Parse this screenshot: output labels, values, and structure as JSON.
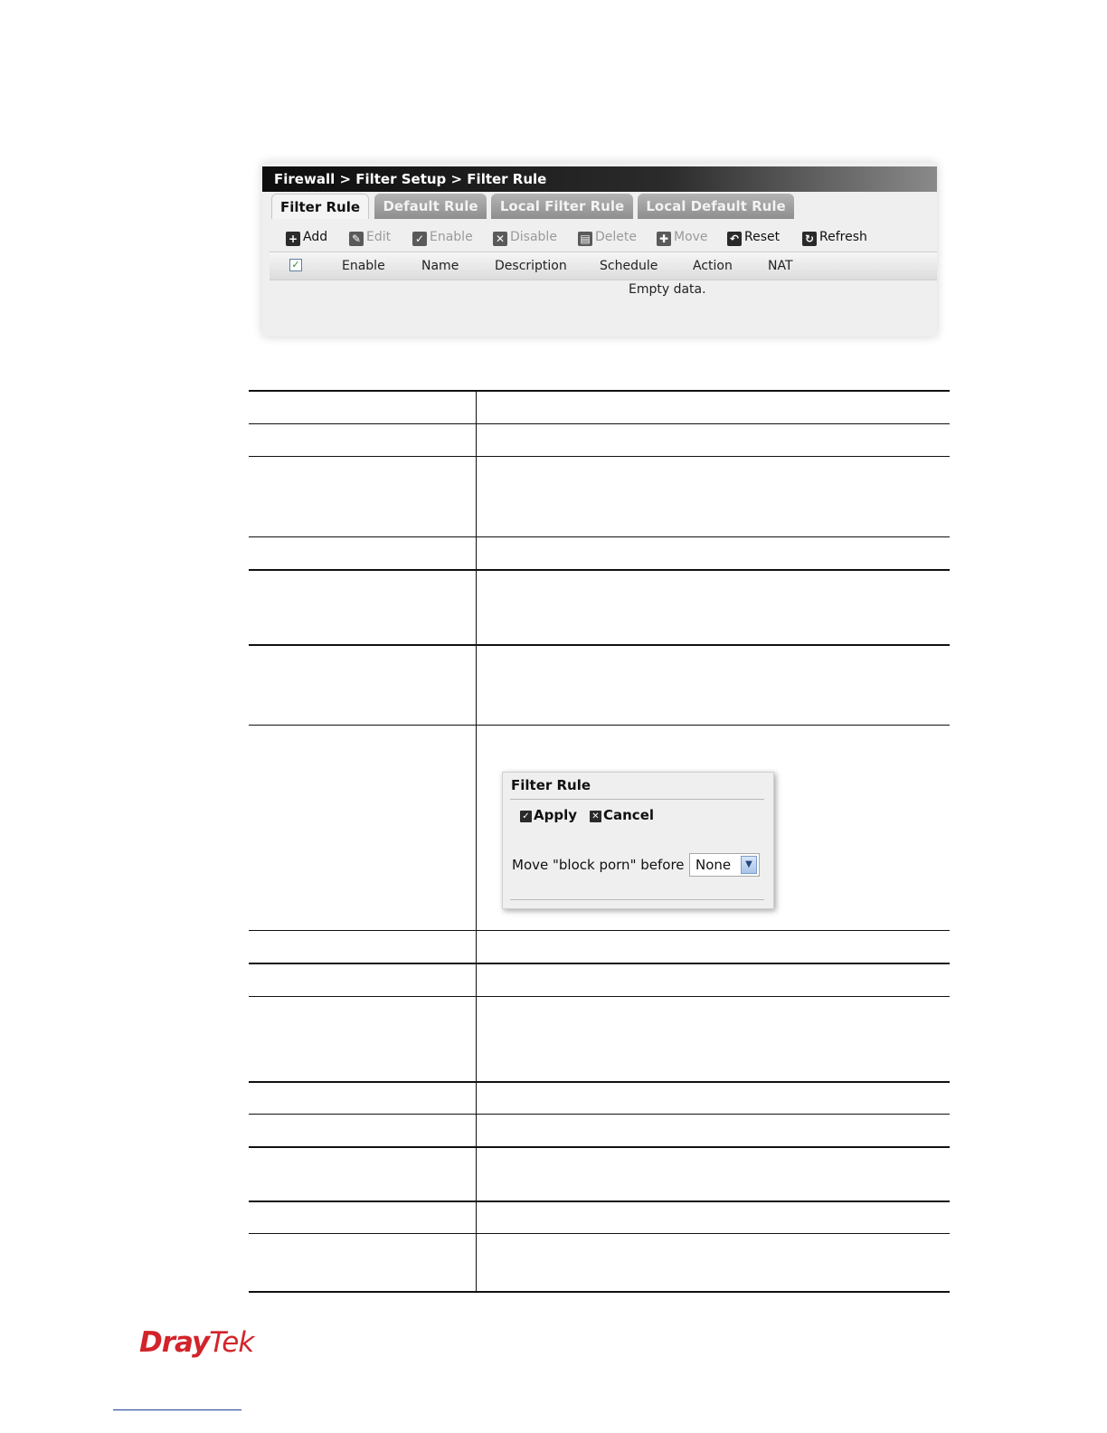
{
  "panel": {
    "breadcrumb": "Firewall > Filter Setup > Filter Rule",
    "tabs": [
      {
        "label": "Filter Rule",
        "active": true
      },
      {
        "label": "Default Rule",
        "active": false
      },
      {
        "label": "Local Filter Rule",
        "active": false
      },
      {
        "label": "Local Default Rule",
        "active": false
      }
    ],
    "toolbar": [
      {
        "label": "Add",
        "icon": "plus-icon",
        "enabled": true
      },
      {
        "label": "Edit",
        "icon": "pencil-icon",
        "enabled": false
      },
      {
        "label": "Enable",
        "icon": "check-icon",
        "enabled": false
      },
      {
        "label": "Disable",
        "icon": "x-icon",
        "enabled": false
      },
      {
        "label": "Delete",
        "icon": "trash-icon",
        "enabled": false
      },
      {
        "label": "Move",
        "icon": "move-icon",
        "enabled": false
      },
      {
        "label": "Reset",
        "icon": "reset-icon",
        "enabled": true
      },
      {
        "label": "Refresh",
        "icon": "refresh-icon",
        "enabled": true
      }
    ],
    "columns": [
      "Enable",
      "Name",
      "Description",
      "Schedule",
      "Action",
      "NAT"
    ],
    "empty_text": "Empty data."
  },
  "move_dialog": {
    "title": "Filter Rule",
    "apply_label": "Apply",
    "cancel_label": "Cancel",
    "move_label": "Move \"block porn\" before",
    "select_value": "None"
  },
  "footer": {
    "logo_dray": "Dray",
    "logo_tek": "Tek"
  },
  "colors": {
    "brand_red": "#d2242a",
    "title_bar": "#1a1a1a",
    "tab_inactive": "#a2a2a2"
  }
}
